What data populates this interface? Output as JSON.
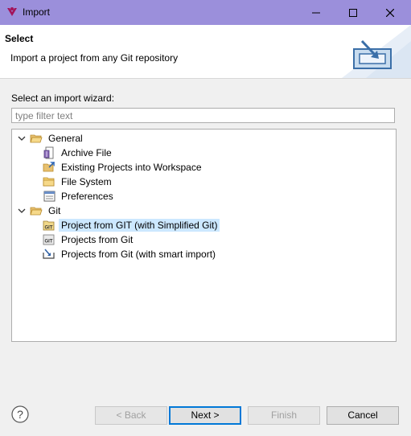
{
  "window": {
    "title": "Import",
    "minimize_glyph": "—",
    "maximize_glyph": "☐",
    "close_glyph": "✕"
  },
  "header": {
    "title": "Select",
    "description": "Import a project from any Git repository"
  },
  "wizard": {
    "label": "Select an import wizard:",
    "filter_placeholder": "type filter text",
    "filter_value": ""
  },
  "tree": [
    {
      "label": "General",
      "icon": "folder-open-icon",
      "expanded": true,
      "level": 0
    },
    {
      "label": "Archive File",
      "icon": "archive-file-icon",
      "level": 1
    },
    {
      "label": "Existing Projects into Workspace",
      "icon": "existing-projects-icon",
      "level": 1
    },
    {
      "label": "File System",
      "icon": "folder-icon",
      "level": 1
    },
    {
      "label": "Preferences",
      "icon": "preferences-icon",
      "level": 1
    },
    {
      "label": "Git",
      "icon": "folder-open-icon",
      "expanded": true,
      "level": 0
    },
    {
      "label": "Project from GIT (with Simplified Git)",
      "icon": "git-icon",
      "level": 1,
      "selected": true
    },
    {
      "label": "Projects from Git",
      "icon": "git-icon",
      "level": 1
    },
    {
      "label": "Projects from Git (with smart import)",
      "icon": "smart-import-icon",
      "level": 1
    }
  ],
  "buttons": {
    "back": "< Back",
    "next": "Next >",
    "finish": "Finish",
    "cancel": "Cancel"
  },
  "colors": {
    "titlebar": "#9b8fdb",
    "selection": "#cce8ff",
    "accent": "#0078d7"
  }
}
